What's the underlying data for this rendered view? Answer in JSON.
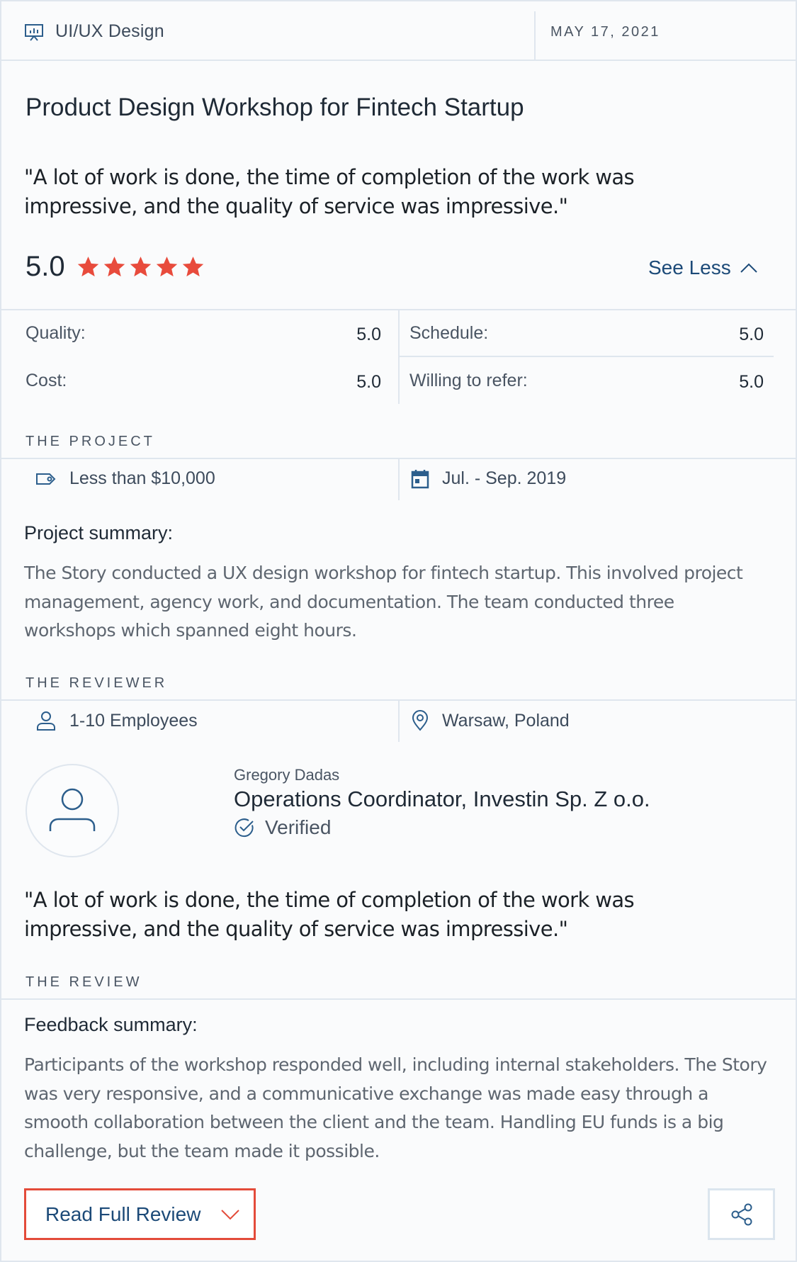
{
  "header": {
    "category_label": "UI/UX Design",
    "date": "MAY 17, 2021"
  },
  "review": {
    "title": "Product Design Workshop for Fintech Startup",
    "quote": "\"A lot of work is done, the time of completion of the work was impressive, and the quality of service was impressive.\"",
    "overall_rating": "5.0",
    "stars": 5,
    "star_color": "#e84b3c",
    "toggle_label": "See Less"
  },
  "scores": [
    {
      "label": "Quality:",
      "value": "5.0"
    },
    {
      "label": "Schedule:",
      "value": "5.0"
    },
    {
      "label": "Cost:",
      "value": "5.0"
    },
    {
      "label": "Willing to refer:",
      "value": "5.0"
    }
  ],
  "project": {
    "heading": "THE PROJECT",
    "budget": "Less than $10,000",
    "budget_icon": "price-tag-icon",
    "timeline": "Jul. - Sep. 2019",
    "timeline_icon": "calendar-icon",
    "summary_heading": "Project summary:",
    "summary": "The Story conducted a UX design workshop for fintech startup. This involved project management, agency work, and documentation. The team conducted three workshops which spanned eight hours."
  },
  "reviewer": {
    "heading": "THE REVIEWER",
    "company_size": "1-10 Employees",
    "company_size_icon": "person-icon",
    "location": "Warsaw, Poland",
    "location_icon": "location-pin-icon",
    "name": "Gregory Dadas",
    "role": "Operations Coordinator, Investin Sp. Z o.o.",
    "verified_label": "Verified"
  },
  "feedback": {
    "heading": "THE REVIEW",
    "summary_heading": "Feedback summary:",
    "summary": "Participants of the workshop responded well, including internal stakeholders. The Story was very responsive, and a communicative exchange was made easy through a smooth collaboration between the client and the team. Handling EU funds is a big challenge, but the team made it possible."
  },
  "actions": {
    "read_full_label": "Read Full Review",
    "share_icon": "share-icon"
  },
  "colors": {
    "accent": "#1c4a78",
    "highlight_border": "#e34b3a"
  }
}
